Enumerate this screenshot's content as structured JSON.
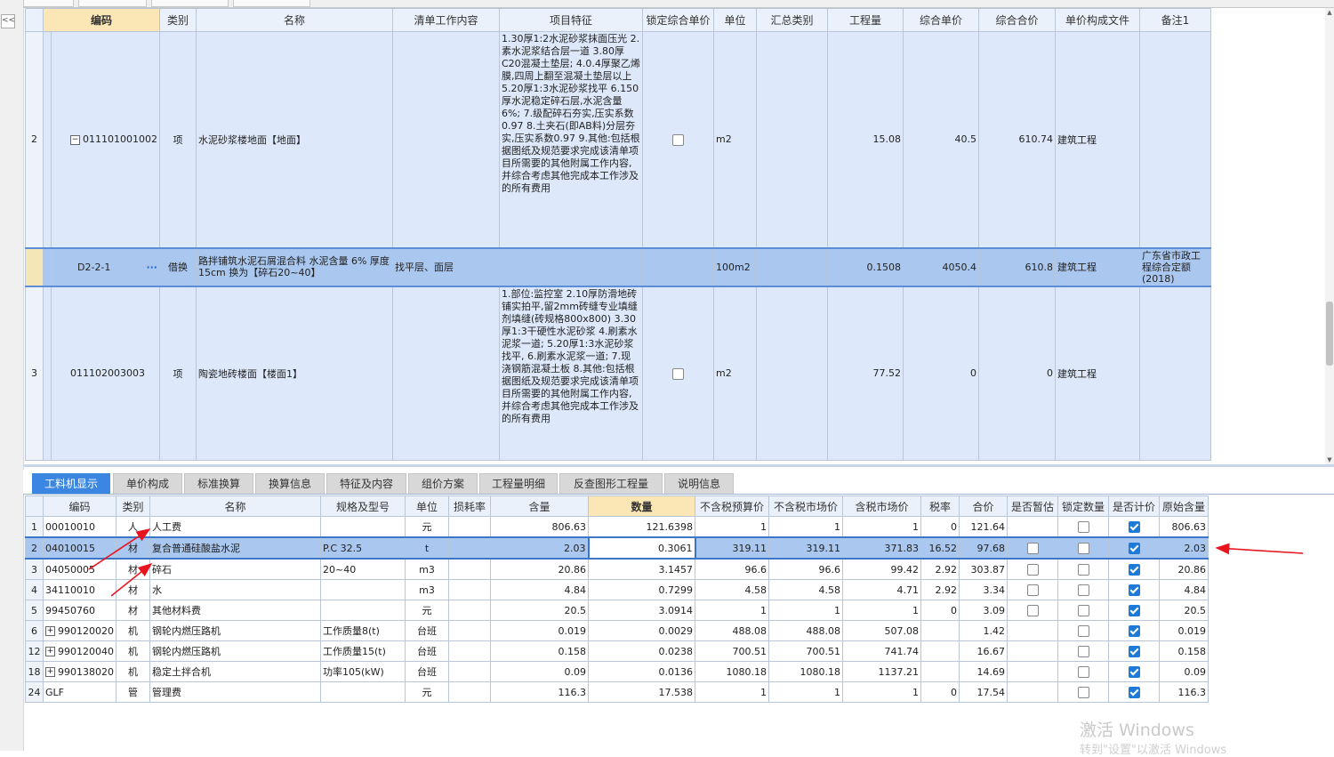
{
  "sidebar": {
    "collapse_label": "<<"
  },
  "upper": {
    "headers": [
      "",
      "编码",
      "类别",
      "名称",
      "清单工作内容",
      "项目特征",
      "锁定综合单价",
      "单位",
      "汇总类别",
      "工程量",
      "综合单价",
      "综合合价",
      "单价构成文件",
      "备注1"
    ],
    "rows": [
      {
        "num": "2",
        "code": "011101001002",
        "type": "项",
        "name": "水泥砂浆楼地面【地面】",
        "work": "",
        "feature": "1.30厚1:2水泥砂浆抹面压光\n2.素水泥浆结合层一道\n3.80厚C20混凝土垫层;\n4.0.4厚聚乙烯膜,四周上翻至混凝土垫层以上\n5.20厚1:3水泥砂浆找平\n6.150厚水泥稳定碎石层,水泥含量6%;\n7.级配碎石夯实,压实系数0.97\n8.土夹石(即AB料)分层夯实,压实系数0.97\n9.其他:包括根据图纸及规范要求完成该清单项目所需要的其他附属工作内容,并综合考虑其他完成本工作涉及的所有费用",
        "unit": "m2",
        "summary": "",
        "qty": "15.08",
        "price": "40.5",
        "total": "610.74",
        "file": "建筑工程",
        "remark": ""
      },
      {
        "num": "",
        "code": "D2-2-1",
        "type": "借换",
        "name": "路拌铺筑水泥石屑混合料 水泥含量 6% 厚度 15cm 换为【碎石20~40】",
        "work": "找平层、面层",
        "feature": "",
        "unit": "100m2",
        "summary": "",
        "qty": "0.1508",
        "price": "4050.4",
        "total": "610.8",
        "file": "建筑工程",
        "remark": "广东省市政工程综合定额(2018)"
      },
      {
        "num": "3",
        "code": "011102003003",
        "type": "项",
        "name": "陶瓷地砖楼面【楼面1】",
        "work": "",
        "feature": "1.部位:监控室\n2.10厚防滑地砖铺实拍平,留2mm砖缝专业填缝剂填缝(砖规格800x800)\n3.30厚1:3干硬性水泥砂浆\n4.刷素水泥浆一道;\n5.20厚1:3水泥砂浆找平,\n6.刷素水泥浆一道;\n7.现浇钢筋混凝土板\n8.其他:包括根据图纸及规范要求完成该清单项目所需要的其他附属工作内容,并综合考虑其他完成本工作涉及的所有费用",
        "unit": "m2",
        "summary": "",
        "qty": "77.52",
        "price": "0",
        "total": "0",
        "file": "建筑工程",
        "remark": ""
      }
    ]
  },
  "tabs": [
    "工料机显示",
    "单价构成",
    "标准换算",
    "换算信息",
    "特征及内容",
    "组价方案",
    "工程量明细",
    "反查图形工程量",
    "说明信息"
  ],
  "lower": {
    "headers": [
      "",
      "编码",
      "类别",
      "名称",
      "规格及型号",
      "单位",
      "损耗率",
      "含量",
      "数量",
      "不含税预算价",
      "不含税市场价",
      "含税市场价",
      "税率",
      "合价",
      "是否暂估",
      "锁定数量",
      "是否计价",
      "原始含量"
    ],
    "rows": [
      {
        "num": "1",
        "code": "00010010",
        "type": "人",
        "name": "人工费",
        "spec": "",
        "unit": "元",
        "loss": "",
        "content": "806.63",
        "qty": "121.6398",
        "p1": "1",
        "p2": "1",
        "p3": "1",
        "tax": "0",
        "total": "121.64",
        "est": false,
        "lock": false,
        "calc": true,
        "orig": "806.63",
        "plus": false,
        "estShown": false
      },
      {
        "num": "2",
        "code": "04010015",
        "type": "材",
        "name": "复合普通硅酸盐水泥",
        "spec": "P.C 32.5",
        "unit": "t",
        "loss": "",
        "content": "2.03",
        "qty": "0.3061",
        "p1": "319.11",
        "p2": "319.11",
        "p3": "371.83",
        "tax": "16.52",
        "total": "97.68",
        "est": false,
        "lock": false,
        "calc": true,
        "orig": "2.03",
        "plus": false,
        "estShown": true
      },
      {
        "num": "3",
        "code": "04050005",
        "type": "材",
        "name": "碎石",
        "spec": "20~40",
        "unit": "m3",
        "loss": "",
        "content": "20.86",
        "qty": "3.1457",
        "p1": "96.6",
        "p2": "96.6",
        "p3": "99.42",
        "tax": "2.92",
        "total": "303.87",
        "est": false,
        "lock": false,
        "calc": true,
        "orig": "20.86",
        "plus": false,
        "estShown": true
      },
      {
        "num": "4",
        "code": "34110010",
        "type": "材",
        "name": "水",
        "spec": "",
        "unit": "m3",
        "loss": "",
        "content": "4.84",
        "qty": "0.7299",
        "p1": "4.58",
        "p2": "4.58",
        "p3": "4.71",
        "tax": "2.92",
        "total": "3.34",
        "est": false,
        "lock": false,
        "calc": true,
        "orig": "4.84",
        "plus": false,
        "estShown": true
      },
      {
        "num": "5",
        "code": "99450760",
        "type": "材",
        "name": "其他材料费",
        "spec": "",
        "unit": "元",
        "loss": "",
        "content": "20.5",
        "qty": "3.0914",
        "p1": "1",
        "p2": "1",
        "p3": "1",
        "tax": "0",
        "total": "3.09",
        "est": false,
        "lock": false,
        "calc": true,
        "orig": "20.5",
        "plus": false,
        "estShown": true
      },
      {
        "num": "6",
        "code": "990120020",
        "type": "机",
        "name": "钢轮内燃压路机",
        "spec": "工作质量8(t)",
        "unit": "台班",
        "loss": "",
        "content": "0.019",
        "qty": "0.0029",
        "p1": "488.08",
        "p2": "488.08",
        "p3": "507.08",
        "tax": "",
        "total": "1.42",
        "est": false,
        "lock": false,
        "calc": true,
        "orig": "0.019",
        "plus": true,
        "estShown": false
      },
      {
        "num": "12",
        "code": "990120040",
        "type": "机",
        "name": "钢轮内燃压路机",
        "spec": "工作质量15(t)",
        "unit": "台班",
        "loss": "",
        "content": "0.158",
        "qty": "0.0238",
        "p1": "700.51",
        "p2": "700.51",
        "p3": "741.74",
        "tax": "",
        "total": "16.67",
        "est": false,
        "lock": false,
        "calc": true,
        "orig": "0.158",
        "plus": true,
        "estShown": false
      },
      {
        "num": "18",
        "code": "990138020",
        "type": "机",
        "name": "稳定土拌合机",
        "spec": "功率105(kW)",
        "unit": "台班",
        "loss": "",
        "content": "0.09",
        "qty": "0.0136",
        "p1": "1080.18",
        "p2": "1080.18",
        "p3": "1137.21",
        "tax": "",
        "total": "14.69",
        "est": false,
        "lock": false,
        "calc": true,
        "orig": "0.09",
        "plus": true,
        "estShown": false
      },
      {
        "num": "24",
        "code": "GLF",
        "type": "管",
        "name": "管理费",
        "spec": "",
        "unit": "元",
        "loss": "",
        "content": "116.3",
        "qty": "17.538",
        "p1": "1",
        "p2": "1",
        "p3": "1",
        "tax": "0",
        "total": "17.54",
        "est": false,
        "lock": false,
        "calc": true,
        "orig": "116.3",
        "plus": false,
        "estShown": false
      }
    ]
  },
  "watermark": {
    "line1": "激活 Windows",
    "line2": "转到\"设置\"以激活 Windows"
  },
  "colors": {
    "accent": "#3a86e0",
    "selected_row": "#a9c7ef",
    "row_bg": "#dde9fb",
    "annotation": "#e8141e"
  }
}
